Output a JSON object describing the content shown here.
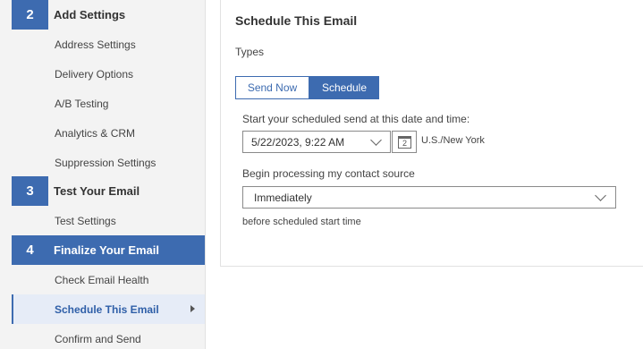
{
  "sidebar": {
    "step2": {
      "number": "2",
      "title": "Add Settings"
    },
    "step2_items": [
      "Address Settings",
      "Delivery Options",
      "A/B Testing",
      "Analytics & CRM",
      "Suppression Settings"
    ],
    "step3": {
      "number": "3",
      "title": "Test Your Email"
    },
    "step3_items": [
      "Test Settings"
    ],
    "step4": {
      "number": "4",
      "title": "Finalize Your Email"
    },
    "step4_items": [
      "Check Email Health",
      "Schedule This Email",
      "Confirm and Send"
    ]
  },
  "main": {
    "title": "Schedule This Email",
    "types_label": "Types",
    "types": {
      "send_now": "Send Now",
      "schedule": "Schedule"
    },
    "start_label": "Start your scheduled send at this date and time:",
    "datetime_value": "5/22/2023, 9:22 AM",
    "calendar_day": "2",
    "timezone": "U.S./New York",
    "processing_label": "Begin processing my contact source",
    "processing_value": "Immediately",
    "before_label": "before scheduled start time"
  },
  "colors": {
    "accent": "#3d6bb0",
    "sidebar_bg": "#f3f3f3",
    "selected_bg": "#e6ecf7"
  }
}
